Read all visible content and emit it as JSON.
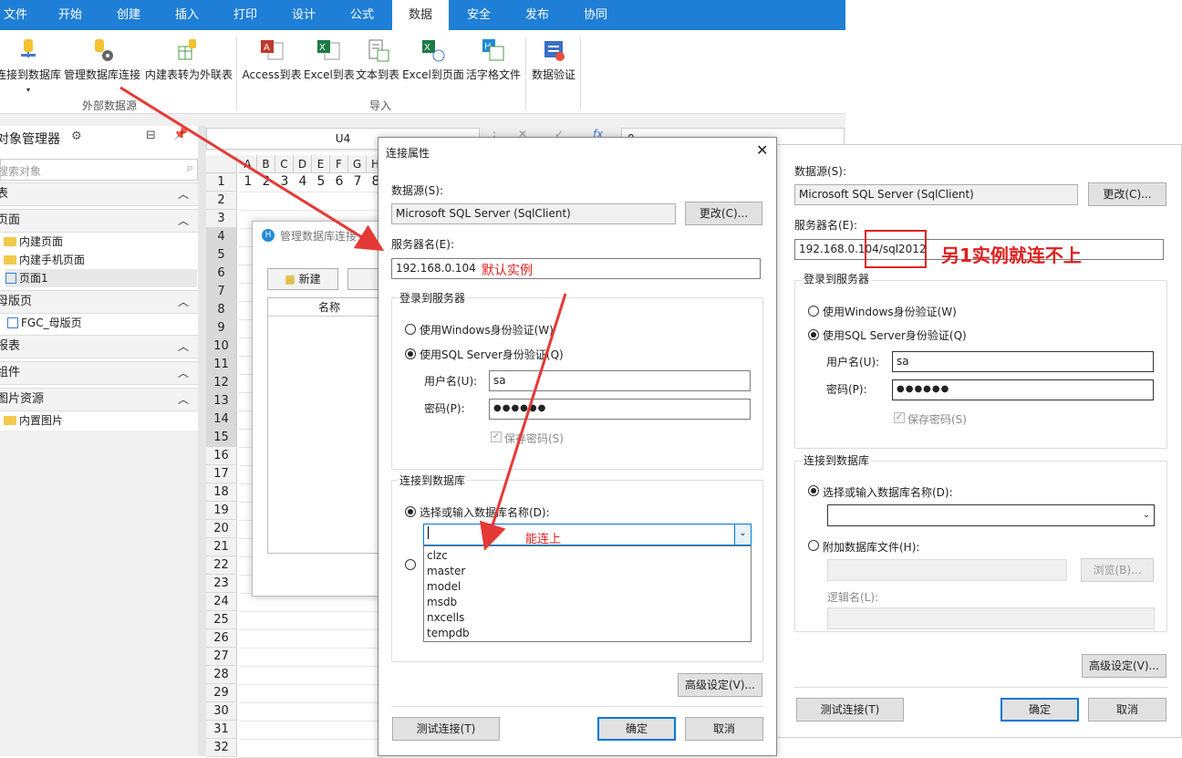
{
  "ribbon": {
    "tabs": [
      "文件",
      "开始",
      "创建",
      "插入",
      "打印",
      "设计",
      "公式",
      "数据",
      "安全",
      "发布",
      "协同"
    ],
    "active_tab": "数据",
    "buttons": {
      "connect_db": "连接到数据库",
      "manage_db": "管理数据库连接",
      "convert_table": "内建表转为外联表",
      "access": "Access到表",
      "excel": "Excel到表",
      "text": "文本到表",
      "excel_page": "Excel到页面",
      "huozige": "活字格文件",
      "validate": "数据验证"
    },
    "groups": {
      "external": "外部数据源",
      "import": "导入"
    }
  },
  "object_manager": {
    "title": "对象管理器",
    "search_placeholder": "搜索对象",
    "sections": {
      "table": "表",
      "page": "页面",
      "master": "母版页",
      "report": "报表",
      "component": "组件",
      "image": "图片资源"
    },
    "items": {
      "builtin_page": "内建页面",
      "builtin_mobile": "内建手机页面",
      "page1": "页面1",
      "fgc_master": "FGC_母版页",
      "builtin_image": "内置图片"
    }
  },
  "sheet": {
    "cell_ref": "U4",
    "formula_value": "0",
    "columns": [
      "A",
      "B",
      "C",
      "D",
      "E",
      "F",
      "G",
      "H"
    ],
    "rows": [
      "1",
      "2",
      "3",
      "4",
      "5",
      "6",
      "7",
      "8",
      "9",
      "10",
      "11",
      "12",
      "13",
      "14",
      "15",
      "16",
      "17",
      "18",
      "19",
      "20",
      "21",
      "22",
      "23",
      "24",
      "25",
      "26",
      "27",
      "28",
      "29",
      "30",
      "31",
      "32"
    ],
    "row1_values": [
      "1",
      "2",
      "3",
      "4",
      "5",
      "6",
      "7",
      "8"
    ]
  },
  "manage_dialog": {
    "title": "管理数据库连接",
    "new_button": "新建",
    "column_name": "名称"
  },
  "conn_dialog": {
    "title": "连接属性",
    "datasource_label": "数据源(S):",
    "datasource_value": "Microsoft SQL Server (SqlClient)",
    "change_button": "更改(C)...",
    "server_label": "服务器名(E):",
    "server_value": "192.168.0.104",
    "annotation_default": "默认实例",
    "login_group": "登录到服务器",
    "windows_auth": "使用Windows身份验证(W)",
    "sql_auth": "使用SQL Server身份验证(Q)",
    "username_label": "用户名(U):",
    "username_value": "sa",
    "password_label": "密码(P):",
    "password_value": "●●●●●●",
    "save_password": "保存密码(S)",
    "db_group": "连接到数据库",
    "select_db": "选择或输入数据库名称(D):",
    "annotation_can_connect": "能连上",
    "db_options": [
      "clzc",
      "master",
      "model",
      "msdb",
      "nxcells",
      "tempdb"
    ],
    "advanced_button": "高级设定(V)...",
    "test_button": "测试连接(T)",
    "ok_button": "确定",
    "cancel_button": "取消"
  },
  "conn_dialog2": {
    "datasource_label": "数据源(S):",
    "datasource_value": "Microsoft SQL Server (SqlClient)",
    "change_button": "更改(C)...",
    "server_label": "服务器名(E):",
    "server_value": "192.168.0.104/sql2012",
    "annotation_other": "另1实例就连不上",
    "login_group": "登录到服务器",
    "windows_auth": "使用Windows身份验证(W)",
    "sql_auth": "使用SQL Server身份验证(Q)",
    "username_label": "用户名(U):",
    "username_value": "sa",
    "password_label": "密码(P):",
    "password_value": "●●●●●●",
    "save_password": "保存密码(S)",
    "db_group": "连接到数据库",
    "select_db": "选择或输入数据库名称(D):",
    "attach_db": "附加数据库文件(H):",
    "browse_button": "浏览(B)...",
    "logical_name": "逻辑名(L):",
    "advanced_button": "高级设定(V)...",
    "test_button": "测试连接(T)",
    "ok_button": "确定",
    "cancel_button": "取消"
  },
  "colors": {
    "ribbon_blue": "#1f7fd6",
    "annotation_red": "#e02020",
    "accent": "#0078d7"
  }
}
